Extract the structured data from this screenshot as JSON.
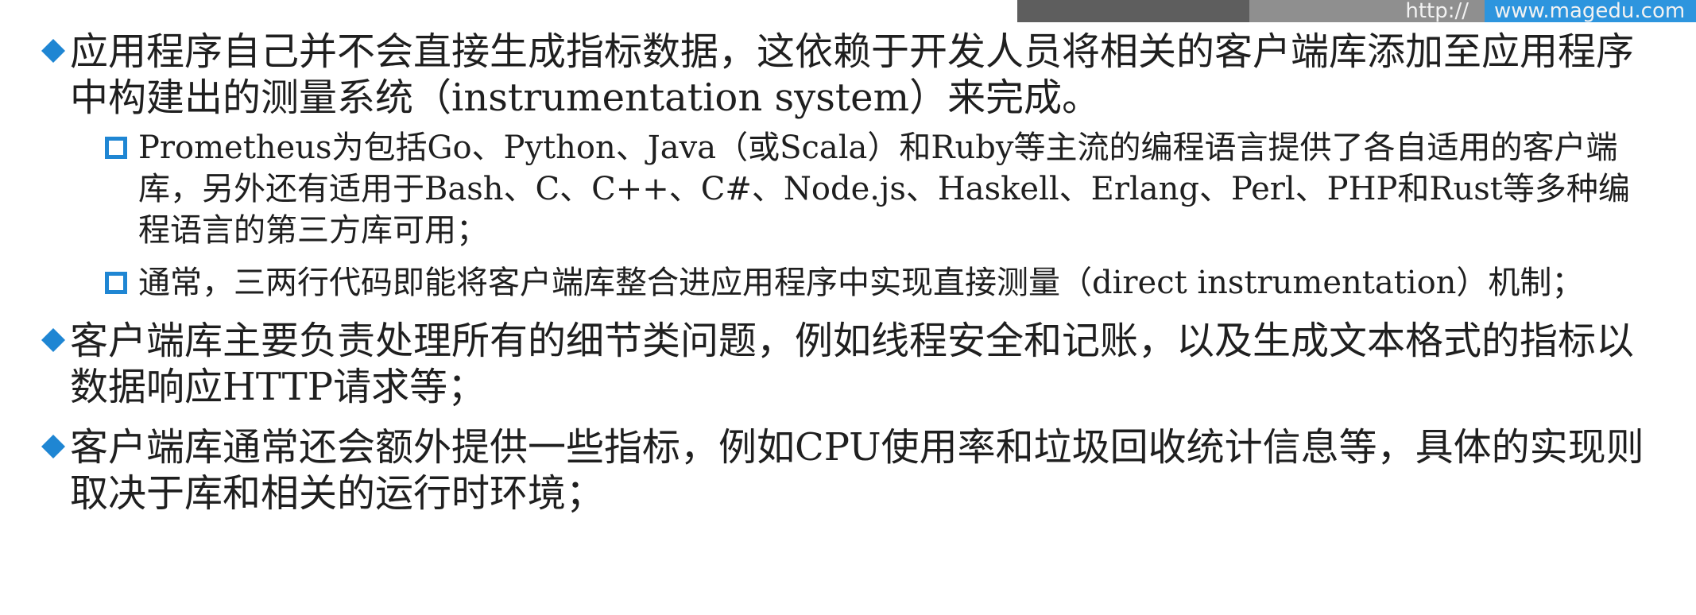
{
  "banner": {
    "protocol": "http://",
    "domain": "www.magedu.com"
  },
  "bullets": [
    {
      "text": "应用程序自己并不会直接生成指标数据，这依赖于开发人员将相关的客户端库添加至应用程序中构建出的测量系统（instrumentation system）来完成。",
      "children": [
        "Prometheus为包括Go、Python、Java（或Scala）和Ruby等主流的编程语言提供了各自适用的客户端库，另外还有适用于Bash、C、C++、C#、Node.js、Haskell、Erlang、Perl、PHP和Rust等多种编程语言的第三方库可用；",
        "通常，三两行代码即能将客户端库整合进应用程序中实现直接测量（direct instrumentation）机制；"
      ]
    },
    {
      "text": "客户端库主要负责处理所有的细节类问题，例如线程安全和记账，以及生成文本格式的指标以数据响应HTTP请求等；"
    },
    {
      "text": "客户端库通常还会额外提供一些指标，例如CPU使用率和垃圾回收统计信息等，具体的实现则取决于库和相关的运行时环境；"
    }
  ],
  "colors": {
    "bullet_primary": "#1f86d3",
    "banner_blue": "#2d95de",
    "banner_dark": "#5e5e5e",
    "banner_grey": "#8f8f8f",
    "text": "#1f1f1f"
  },
  "icons": {
    "level1": "diamond-bullet-icon",
    "level2": "hollow-square-bullet-icon"
  }
}
